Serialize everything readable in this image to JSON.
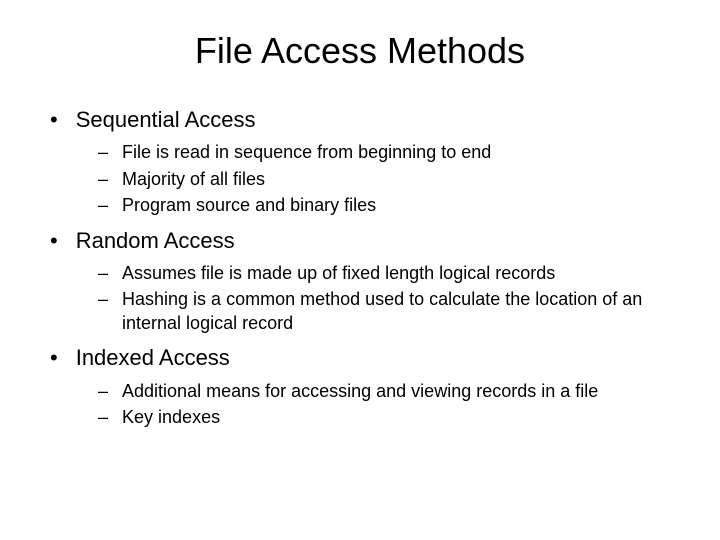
{
  "title": "File Access Methods",
  "sections": [
    {
      "heading": "Sequential Access",
      "points": [
        "File is read in sequence from beginning to end",
        "Majority of all files",
        "Program source and binary files"
      ]
    },
    {
      "heading": "Random Access",
      "points": [
        "Assumes file is made up of fixed length logical records",
        "Hashing is a common method used to calculate the location of an internal logical record"
      ]
    },
    {
      "heading": "Indexed Access",
      "points": [
        "Additional means for accessing and viewing records in a file",
        "Key indexes"
      ]
    }
  ]
}
